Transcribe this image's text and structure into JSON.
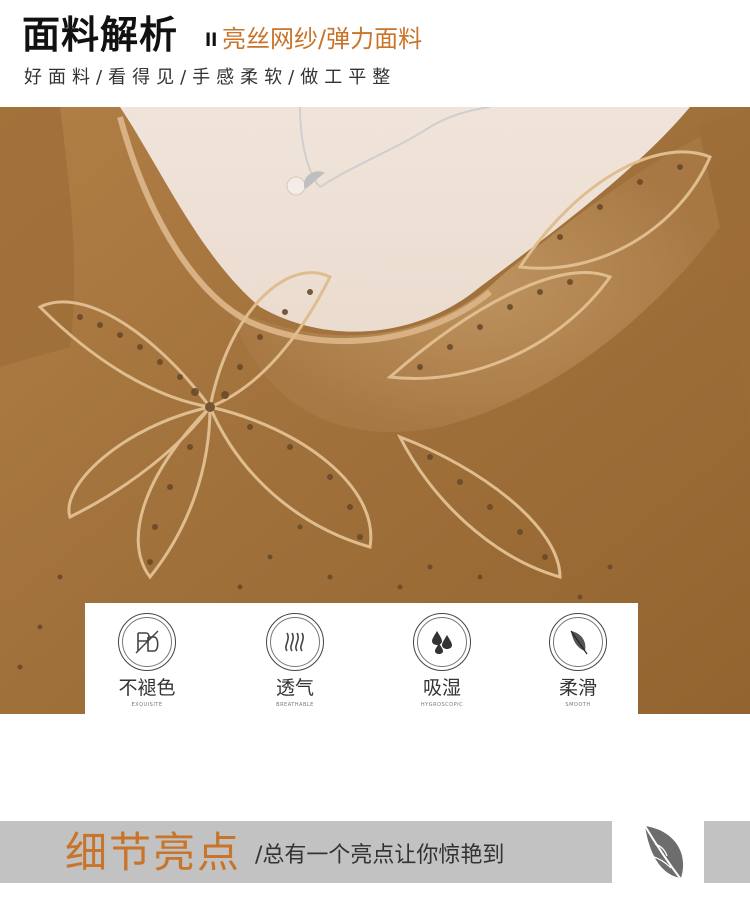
{
  "header": {
    "title": "面料解析",
    "separator": "ll",
    "subtitle": "亮丝网纱/弹力面料",
    "tagline": "好面料/看得见/手感柔软/做工平整"
  },
  "features": [
    {
      "icon": "no-fade-icon",
      "label": "不褪色",
      "en": "EXQUISITE"
    },
    {
      "icon": "breathable-icon",
      "label": "透气",
      "en": "BREATHABLE"
    },
    {
      "icon": "moisture-drops-icon",
      "label": "吸湿",
      "en": "HYGROSCOPIC"
    },
    {
      "icon": "feather-icon",
      "label": "柔滑",
      "en": "SMOOTH"
    }
  ],
  "highlight": {
    "title": "细节亮点",
    "subtitle": "/总有一个亮点让你惊艳到"
  },
  "colors": {
    "accent": "#c8742a",
    "fabric": "#a8763e",
    "bar": "#c2c2c2"
  }
}
